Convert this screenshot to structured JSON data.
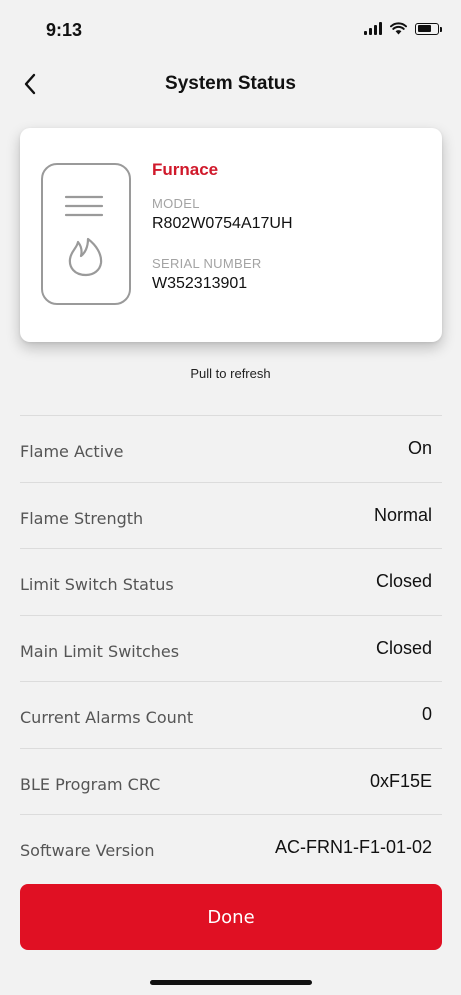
{
  "status_bar": {
    "time": "9:13"
  },
  "nav": {
    "title": "System Status"
  },
  "device": {
    "name": "Furnace",
    "model_label": "MODEL",
    "model_value": "R802W0754A17UH",
    "serial_label": "SERIAL NUMBER",
    "serial_value": "W352313901"
  },
  "pull_to_refresh": "Pull to refresh",
  "rows": [
    {
      "label": "Flame Active",
      "value": "On"
    },
    {
      "label": "Flame Strength",
      "value": "Normal"
    },
    {
      "label": "Limit Switch Status",
      "value": "Closed"
    },
    {
      "label": "Main Limit Switches",
      "value": "Closed"
    },
    {
      "label": "Current Alarms Count",
      "value": "0"
    },
    {
      "label": "BLE Program CRC",
      "value": "0xF15E"
    },
    {
      "label": "Software Version",
      "value": "AC-FRN1-F1-01-02"
    }
  ],
  "done_button": "Done",
  "colors": {
    "accent": "#e01023",
    "brand_red_text": "#d0192b",
    "background": "#f2f2f2"
  },
  "icons": [
    "signal-icon",
    "wifi-icon",
    "battery-icon",
    "back-chevron-icon",
    "flame-icon"
  ]
}
